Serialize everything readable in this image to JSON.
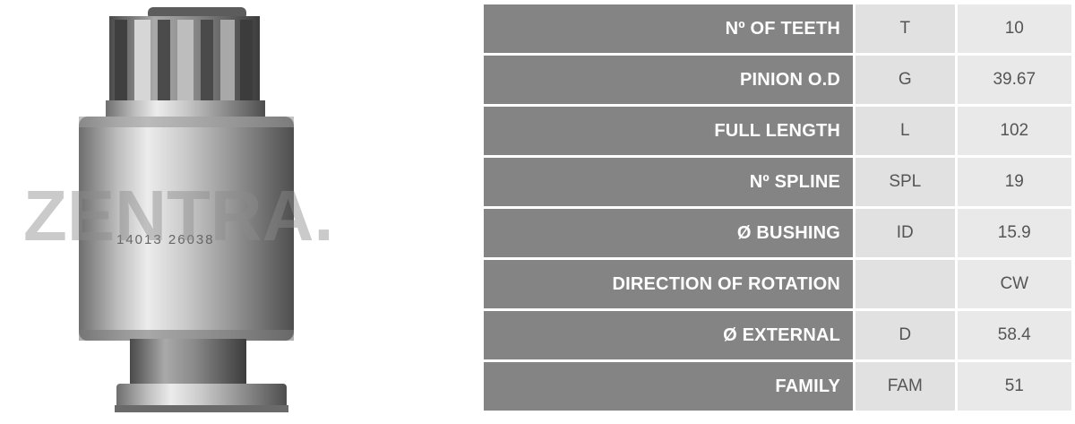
{
  "product_image": {
    "description_icon": "starter-drive-pinion-icon",
    "watermark": "ZENTRA.",
    "engraving": "14013 26038"
  },
  "specs": [
    {
      "label": "Nº OF TEETH",
      "code": "T",
      "value": "10"
    },
    {
      "label": "PINION O.D",
      "code": "G",
      "value": "39.67"
    },
    {
      "label": "FULL LENGTH",
      "code": "L",
      "value": "102"
    },
    {
      "label": "Nº SPLINE",
      "code": "SPL",
      "value": "19"
    },
    {
      "label": "Ø BUSHING",
      "code": "ID",
      "value": "15.9"
    },
    {
      "label": "DIRECTION OF ROTATION",
      "code": "",
      "value": "CW"
    },
    {
      "label": "Ø EXTERNAL",
      "code": "D",
      "value": "58.4"
    },
    {
      "label": "FAMILY",
      "code": "FAM",
      "value": "51"
    }
  ],
  "colors": {
    "label_bg": "#848484",
    "code_bg": "#e1e1e1",
    "value_bg": "#e9e9e9",
    "metal_light": "#d9d9d9",
    "metal_dark": "#5a5a5a"
  }
}
